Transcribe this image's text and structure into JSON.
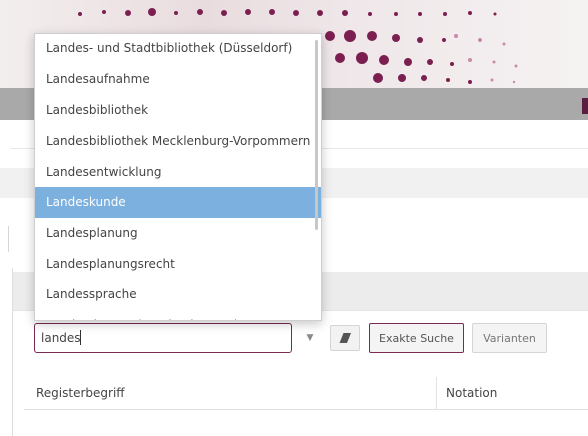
{
  "autocomplete": {
    "items": [
      "Landes- und Stadtbibliothek (Düsseldorf)",
      "Landesaufnahme",
      "Landesbibliothek",
      "Landesbibliothek Mecklenburg-Vorpommern",
      "Landesentwicklung",
      "Landeskunde",
      "Landesplanung",
      "Landesplanungsrecht",
      "Landessprache",
      "Landestheater (Sondershausen)"
    ],
    "selected": "Landeskunde"
  },
  "search": {
    "value": "landes"
  },
  "buttons": {
    "exact_search": "Exakte Suche",
    "variants": "Varianten"
  },
  "table": {
    "columns": [
      "Registerbegriff",
      "Notation"
    ]
  },
  "colors": {
    "accent": "#7a2a52",
    "selected_item": "#7cb0df",
    "navbar": "#a9a9a9"
  },
  "icons": {
    "dropdown": "chevron-down-icon",
    "clear": "eraser-icon"
  }
}
